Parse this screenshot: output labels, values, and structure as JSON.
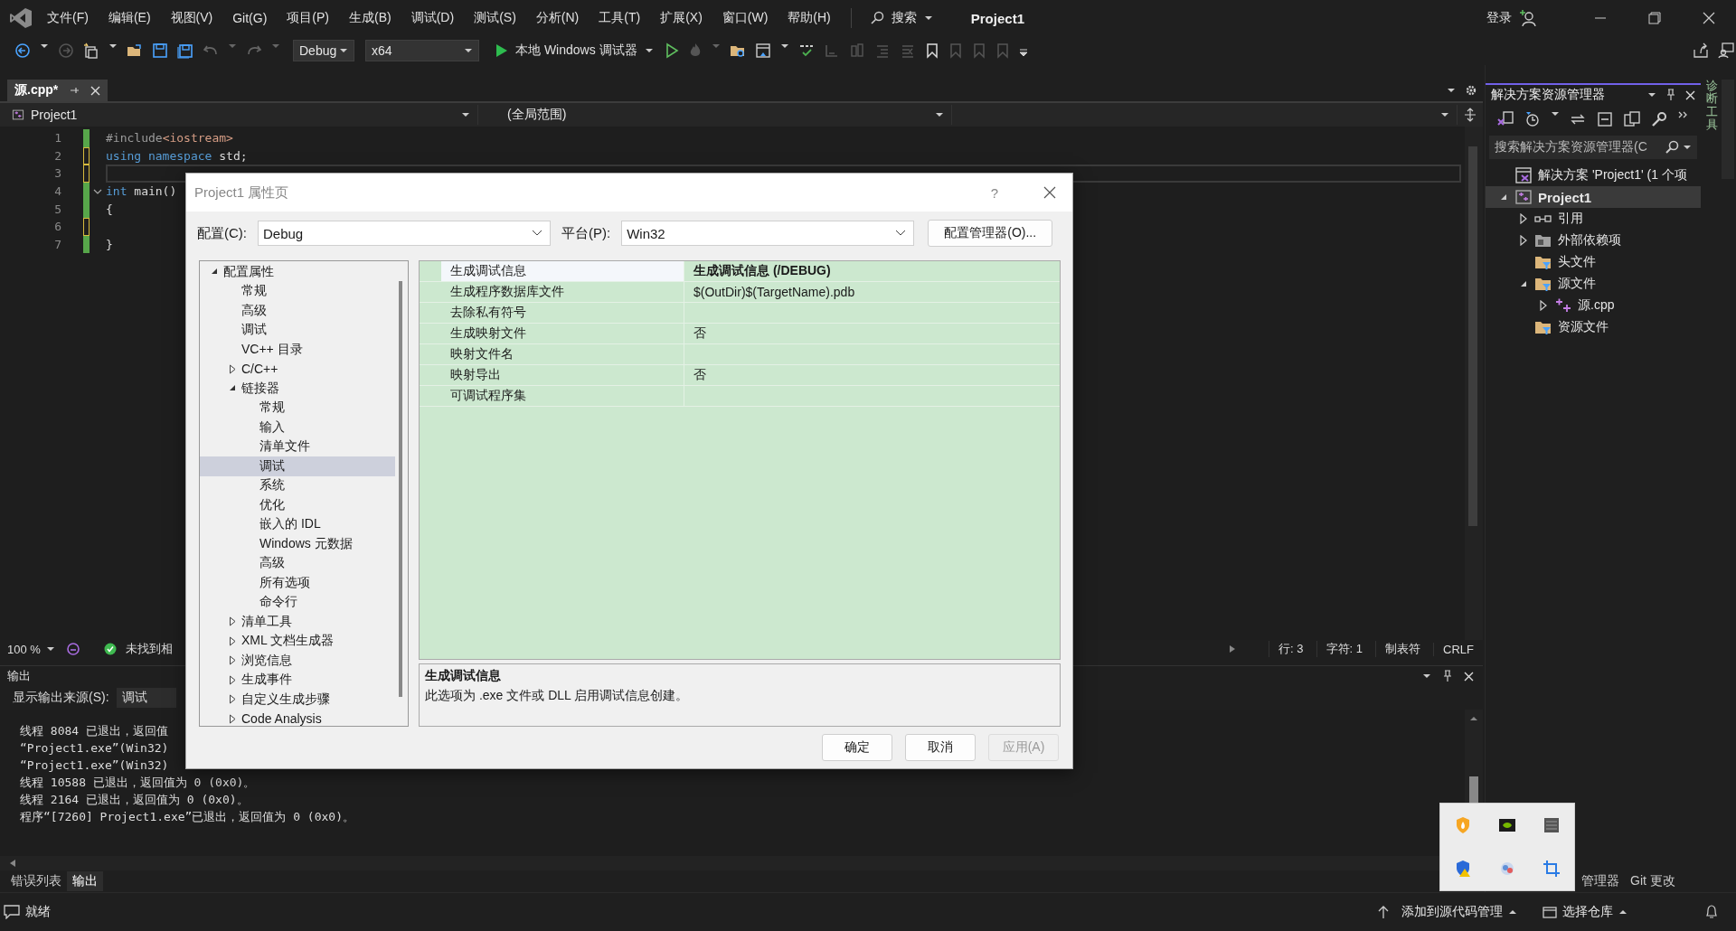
{
  "menu": {
    "items": [
      "文件(F)",
      "编辑(E)",
      "视图(V)",
      "Git(G)",
      "项目(P)",
      "生成(B)",
      "调试(D)",
      "测试(S)",
      "分析(N)",
      "工具(T)",
      "扩展(X)",
      "窗口(W)",
      "帮助(H)"
    ],
    "search": "搜索",
    "title": "Project1",
    "account": "登录"
  },
  "toolbar": {
    "configuration": "Debug",
    "platform": "x64",
    "debugger": "本地 Windows 调试器"
  },
  "document_tab": {
    "label": "源.cpp*",
    "selected": true
  },
  "nav_bar": {
    "project": "Project1",
    "scope": "(全局范围)"
  },
  "editor": {
    "lines": [
      {
        "number": "1",
        "saved": true,
        "current": false,
        "foldable": false,
        "tokens": [
          {
            "kind": "preprocessor",
            "text": "#include"
          },
          {
            "kind": "header",
            "text": "<iostream>"
          }
        ]
      },
      {
        "number": "2",
        "saved": false,
        "current": false,
        "foldable": false,
        "tokens": [
          {
            "kind": "keyword",
            "text": "using "
          },
          {
            "kind": "keyword",
            "text": "namespace "
          },
          {
            "kind": "plain",
            "text": "std;"
          }
        ]
      },
      {
        "number": "3",
        "saved": false,
        "current": true,
        "foldable": false
      },
      {
        "number": "4",
        "saved": true,
        "current": false,
        "foldable": true,
        "tokens": [
          {
            "kind": "keyword",
            "text": "int "
          },
          {
            "kind": "plain",
            "text": "main()"
          }
        ]
      },
      {
        "number": "5",
        "saved": true,
        "current": false,
        "foldable": false,
        "tokens": [
          {
            "kind": "plain",
            "text": "{"
          }
        ]
      },
      {
        "number": "6",
        "saved": false,
        "current": false,
        "foldable": false
      },
      {
        "number": "7",
        "saved": true,
        "current": false,
        "foldable": false,
        "tokens": [
          {
            "kind": "plain",
            "text": "}"
          }
        ]
      }
    ]
  },
  "editor_status": {
    "zoom": "100 %",
    "issues": "未找到相",
    "line": "行: 3",
    "column": "字符: 1",
    "indent": "制表符",
    "line_ending": "CRLF"
  },
  "output": {
    "title": "输出",
    "source_label": "显示输出来源(S):",
    "source": "调试",
    "lines": [
      "线程 8084 已退出，返回值",
      "“Project1.exe”(Win32)",
      "“Project1.exe”(Win32)",
      "线程 10588 已退出，返回值为 0 (0x0)。",
      "线程 2164 已退出，返回值为 0 (0x0)。",
      "程序“[7260] Project1.exe”已退出，返回值为 0 (0x0)。"
    ]
  },
  "bottom_tabs": [
    {
      "label": "错误列表",
      "selected": false
    },
    {
      "label": "输出",
      "selected": true
    }
  ],
  "solution_explorer": {
    "title": "解决方案资源管理器",
    "search": {
      "placeholder": "搜索解决方案资源管理器(C"
    },
    "tree": [
      {
        "kind": "solution",
        "label": "解决方案 'Project1' (1 个项",
        "selected": false
      },
      {
        "kind": "project",
        "label": "Project1",
        "selected": true,
        "expanded": true,
        "children": [
          {
            "kind": "references",
            "label": "引用",
            "selected": false,
            "expanded": false
          },
          {
            "kind": "external",
            "label": "外部依赖项",
            "selected": false,
            "expanded": false
          },
          {
            "kind": "filter",
            "label": "头文件",
            "selected": false
          },
          {
            "kind": "filter",
            "label": "源文件",
            "selected": false,
            "expanded": true,
            "children": [
              {
                "kind": "cpp",
                "label": "源.cpp",
                "selected": false,
                "expanded": false
              }
            ]
          },
          {
            "kind": "filter",
            "label": "资源文件",
            "selected": false
          }
        ]
      }
    ]
  },
  "right_tabs": [
    {
      "label": "管理器",
      "selected": false
    },
    {
      "label": "Git 更改",
      "selected": false
    }
  ],
  "side_tab": "诊断工具",
  "status_bar": {
    "status": "就绪",
    "source_control": "添加到源代码管理",
    "repository": "选择仓库"
  },
  "dialog": {
    "title": "Project1 属性页",
    "help": "?",
    "configuration_label": "配置(C):",
    "configuration": "Debug",
    "platform_label": "平台(P):",
    "platform": "Win32",
    "manager_button": "配置管理器(O)...",
    "tree": [
      {
        "label": "配置属性",
        "selected": false,
        "expanded": true,
        "children": [
          {
            "label": "常规",
            "selected": false
          },
          {
            "label": "高级",
            "selected": false
          },
          {
            "label": "调试",
            "selected": false
          },
          {
            "label": "VC++ 目录",
            "selected": false
          },
          {
            "label": "C/C++",
            "selected": false,
            "expanded": false
          },
          {
            "label": "链接器",
            "selected": false,
            "expanded": true,
            "children": [
              {
                "label": "常规",
                "selected": false
              },
              {
                "label": "输入",
                "selected": false
              },
              {
                "label": "清单文件",
                "selected": false
              },
              {
                "label": "调试",
                "selected": true
              },
              {
                "label": "系统",
                "selected": false
              },
              {
                "label": "优化",
                "selected": false
              },
              {
                "label": "嵌入的 IDL",
                "selected": false
              },
              {
                "label": "Windows 元数据",
                "selected": false
              },
              {
                "label": "高级",
                "selected": false
              },
              {
                "label": "所有选项",
                "selected": false
              },
              {
                "label": "命令行",
                "selected": false
              }
            ]
          },
          {
            "label": "清单工具",
            "selected": false,
            "expanded": false
          },
          {
            "label": "XML 文档生成器",
            "selected": false,
            "expanded": false
          },
          {
            "label": "浏览信息",
            "selected": false,
            "expanded": false
          },
          {
            "label": "生成事件",
            "selected": false,
            "expanded": false
          },
          {
            "label": "自定义生成步骤",
            "selected": false,
            "expanded": false
          },
          {
            "label": "Code Analysis",
            "selected": false,
            "expanded": false
          }
        ]
      }
    ],
    "properties": [
      {
        "name": "生成调试信息",
        "value": "生成调试信息 (/DEBUG)",
        "selected": true,
        "modified": true
      },
      {
        "name": "生成程序数据库文件",
        "value": "$(OutDir)$(TargetName).pdb",
        "selected": false,
        "modified": false
      },
      {
        "name": "去除私有符号",
        "selected": false
      },
      {
        "name": "生成映射文件",
        "value": "否",
        "selected": false,
        "modified": false
      },
      {
        "name": "映射文件名",
        "selected": false
      },
      {
        "name": "映射导出",
        "value": "否",
        "selected": false,
        "modified": false
      },
      {
        "name": "可调试程序集",
        "selected": false
      }
    ],
    "description": {
      "title": "生成调试信息",
      "text": "此选项为 .exe 文件或 DLL 启用调试信息创建。"
    },
    "buttons": [
      {
        "label": "确定",
        "disabled": false
      },
      {
        "label": "取消",
        "disabled": false
      },
      {
        "label": "应用(A)",
        "disabled": true
      }
    ]
  }
}
